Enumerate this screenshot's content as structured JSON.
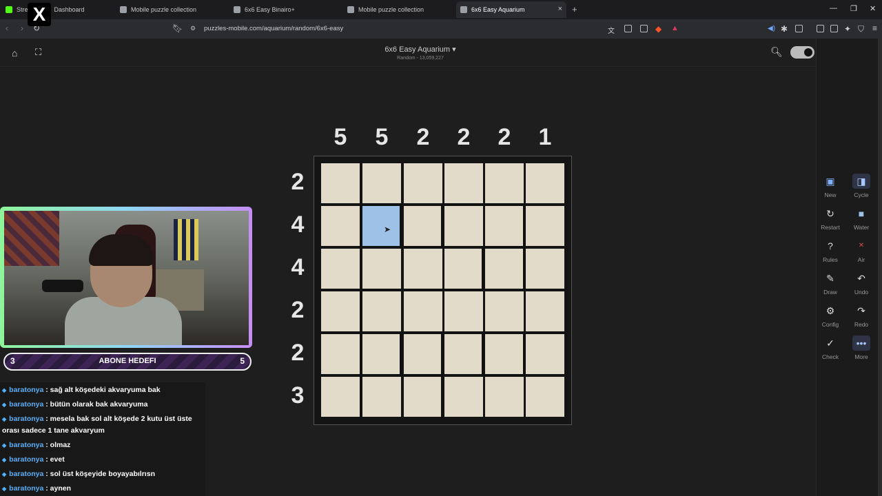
{
  "browser": {
    "tabs": [
      {
        "label": "Stre",
        "extra": "Dashboard"
      },
      {
        "label": "Mobile puzzle collection"
      },
      {
        "label": "6x6 Easy Binairo+"
      },
      {
        "label": "Mobile puzzle collection"
      },
      {
        "label": "6x6 Easy Aquarium",
        "active": true
      }
    ],
    "url": "puzzles-mobile.com/aquarium/random/6x6-easy",
    "new_tab": "+",
    "close_tab": "×"
  },
  "page": {
    "title": "6x6 Easy Aquarium ▾",
    "subtitle": "Random - 13,059,227"
  },
  "puzzle": {
    "col_clues": [
      "5",
      "5",
      "2",
      "2",
      "2",
      "1"
    ],
    "row_clues": [
      "2",
      "4",
      "4",
      "2",
      "2",
      "3"
    ],
    "water_cells": [
      [
        1,
        1
      ]
    ]
  },
  "tools": [
    {
      "label": "New",
      "icon": "new-dice-icon"
    },
    {
      "label": "Cycle",
      "icon": "cycle-icon"
    },
    {
      "label": "Restart",
      "icon": "restart-icon"
    },
    {
      "label": "Water",
      "icon": "water-icon"
    },
    {
      "label": "Rules",
      "icon": "rules-icon"
    },
    {
      "label": "Air",
      "icon": "air-icon"
    },
    {
      "label": "Draw",
      "icon": "draw-icon"
    },
    {
      "label": "Undo",
      "icon": "undo-icon"
    },
    {
      "label": "Config",
      "icon": "config-icon"
    },
    {
      "label": "Redo",
      "icon": "redo-icon"
    },
    {
      "label": "Check",
      "icon": "check-icon"
    },
    {
      "label": "More",
      "icon": "more-icon"
    }
  ],
  "stream": {
    "goal_label": "ABONE HEDEFI",
    "goal_current": "3",
    "goal_target": "5",
    "chat": [
      {
        "user": "baratonya",
        "text": ": sağ alt köşedeki akvaryuma bak"
      },
      {
        "user": "baratonya",
        "text": ": bütün olarak bak akvaryuma"
      },
      {
        "user": "baratonya",
        "text": ": mesela bak sol alt köşede 2 kutu üst üste",
        "cont": "orası sadece 1 tane akvaryum"
      },
      {
        "user": "baratonya",
        "text": ": olmaz"
      },
      {
        "user": "baratonya",
        "text": ": evet"
      },
      {
        "user": "baratonya",
        "text": ": sol üst köşeyide boyayabılrısn"
      },
      {
        "user": "baratonya",
        "text": ": aynen"
      }
    ]
  }
}
